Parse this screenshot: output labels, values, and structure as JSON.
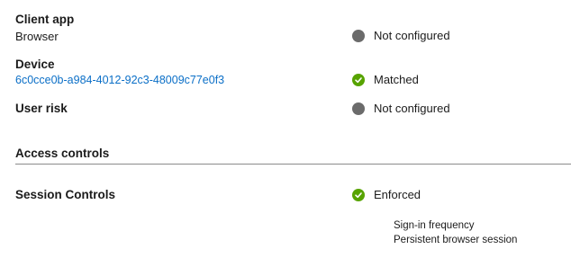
{
  "rows": {
    "client_app": {
      "label": "Client app",
      "value": "Browser",
      "status": "Not configured",
      "status_icon": "not-configured-icon"
    },
    "device": {
      "label": "Device",
      "value": "6c0cce0b-a984-4012-92c3-48009c77e0f3",
      "status": "Matched",
      "status_icon": "matched-check-icon"
    },
    "user_risk": {
      "label": "User risk",
      "status": "Not configured",
      "status_icon": "not-configured-icon"
    }
  },
  "access_controls": {
    "title": "Access controls"
  },
  "session_controls": {
    "label": "Session Controls",
    "status": "Enforced",
    "status_icon": "enforced-check-icon",
    "details": [
      "Sign-in frequency",
      "Persistent browser session"
    ]
  },
  "colors": {
    "not_configured": "#6b6b6b",
    "success": "#57a300",
    "link": "#0b6fc7",
    "divider": "#8a8a8a"
  }
}
